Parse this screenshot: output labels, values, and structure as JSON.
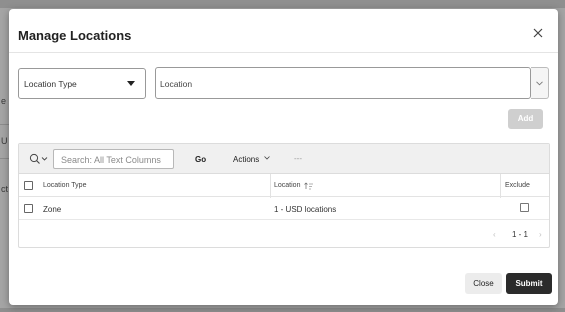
{
  "background": {
    "fragments": [
      "e P",
      "U",
      "ct"
    ]
  },
  "modal": {
    "title": "Manage Locations",
    "close_icon": "close-icon"
  },
  "filters": {
    "location_type_select": {
      "value": "Location Type",
      "icon": "caret-down-icon"
    },
    "location_input": {
      "placeholder": "Location",
      "icon": "chevron-down-icon"
    },
    "add_label": "Add"
  },
  "toolbar": {
    "search_icon": "search-icon",
    "search_placeholder": "Search: All Text Columns",
    "go_label": "Go",
    "actions_label": "Actions",
    "more_label": "---"
  },
  "table": {
    "columns": [
      "Location Type",
      "Location",
      "Exclude"
    ],
    "rows": [
      {
        "location_type": "Zone",
        "location": "1 - USD locations",
        "exclude": false
      }
    ],
    "pagination": "1 - 1"
  },
  "footer": {
    "close_label": "Close",
    "submit_label": "Submit"
  },
  "colors": {
    "overlay": "#a5a5a5",
    "primary_button": "#2b2b2b",
    "disabled_button": "#cfcfcf"
  }
}
